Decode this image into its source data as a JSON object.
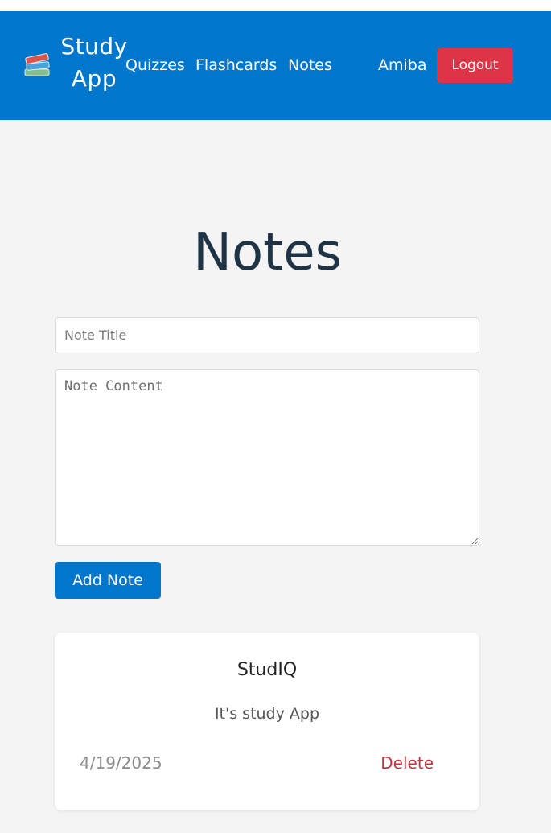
{
  "colors": {
    "nav_bg": "#0077cc",
    "logout_bg": "#dc3545",
    "primary_button": "#0077cc",
    "delete_text": "#c4323f",
    "page_bg": "#f4f4f4"
  },
  "navbar": {
    "brand_icon": "books-icon",
    "brand_title": "Study App",
    "links": {
      "quizzes": "Quizzes",
      "flashcards": "Flashcards",
      "notes": "Notes"
    },
    "user_name": "Amiba",
    "logout_label": "Logout"
  },
  "main": {
    "title": "Notes",
    "form": {
      "title_value": "",
      "title_placeholder": "Note Title",
      "content_value": "",
      "content_placeholder": "Note Content",
      "submit_label": "Add Note"
    },
    "notes": [
      {
        "title": "StudIQ",
        "content": "It's study App",
        "date": "4/19/2025",
        "delete_label": "Delete"
      }
    ]
  }
}
